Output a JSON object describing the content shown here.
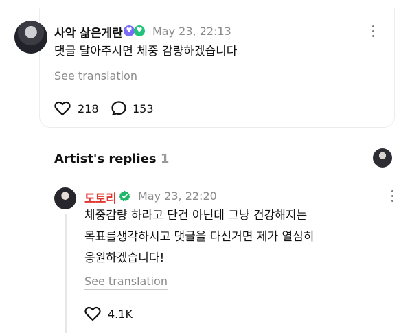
{
  "post": {
    "username": "사악 삶은게란",
    "timestamp": "May 23, 22:13",
    "text": "댓글 달아주시면 체중 감량하겠습니다",
    "translate_label": "See translation",
    "likes": "218",
    "comments": "153"
  },
  "replies_section": {
    "title": "Artist's replies",
    "count": "1"
  },
  "reply": {
    "username": "도토리",
    "timestamp": "May 23, 22:20",
    "lines": [
      "체중감량 하라고 단건 아닌데 그냥 건강해지는",
      "목표를생각하시고 댓글을 다신거면 제가 열심히",
      "응원하겠습니다!"
    ],
    "translate_label": "See translation",
    "likes": "4.1K"
  },
  "colors": {
    "artist_name": "#e0372f",
    "verified": "#1fb86a",
    "badge_purple": "#7b6cf6",
    "badge_green": "#21c27a",
    "muted": "#8a8a8a"
  },
  "icons": [
    "heart-icon",
    "comment-bubble-icon",
    "kebab-menu-icon",
    "verified-check-icon",
    "membership-badge-icon"
  ]
}
